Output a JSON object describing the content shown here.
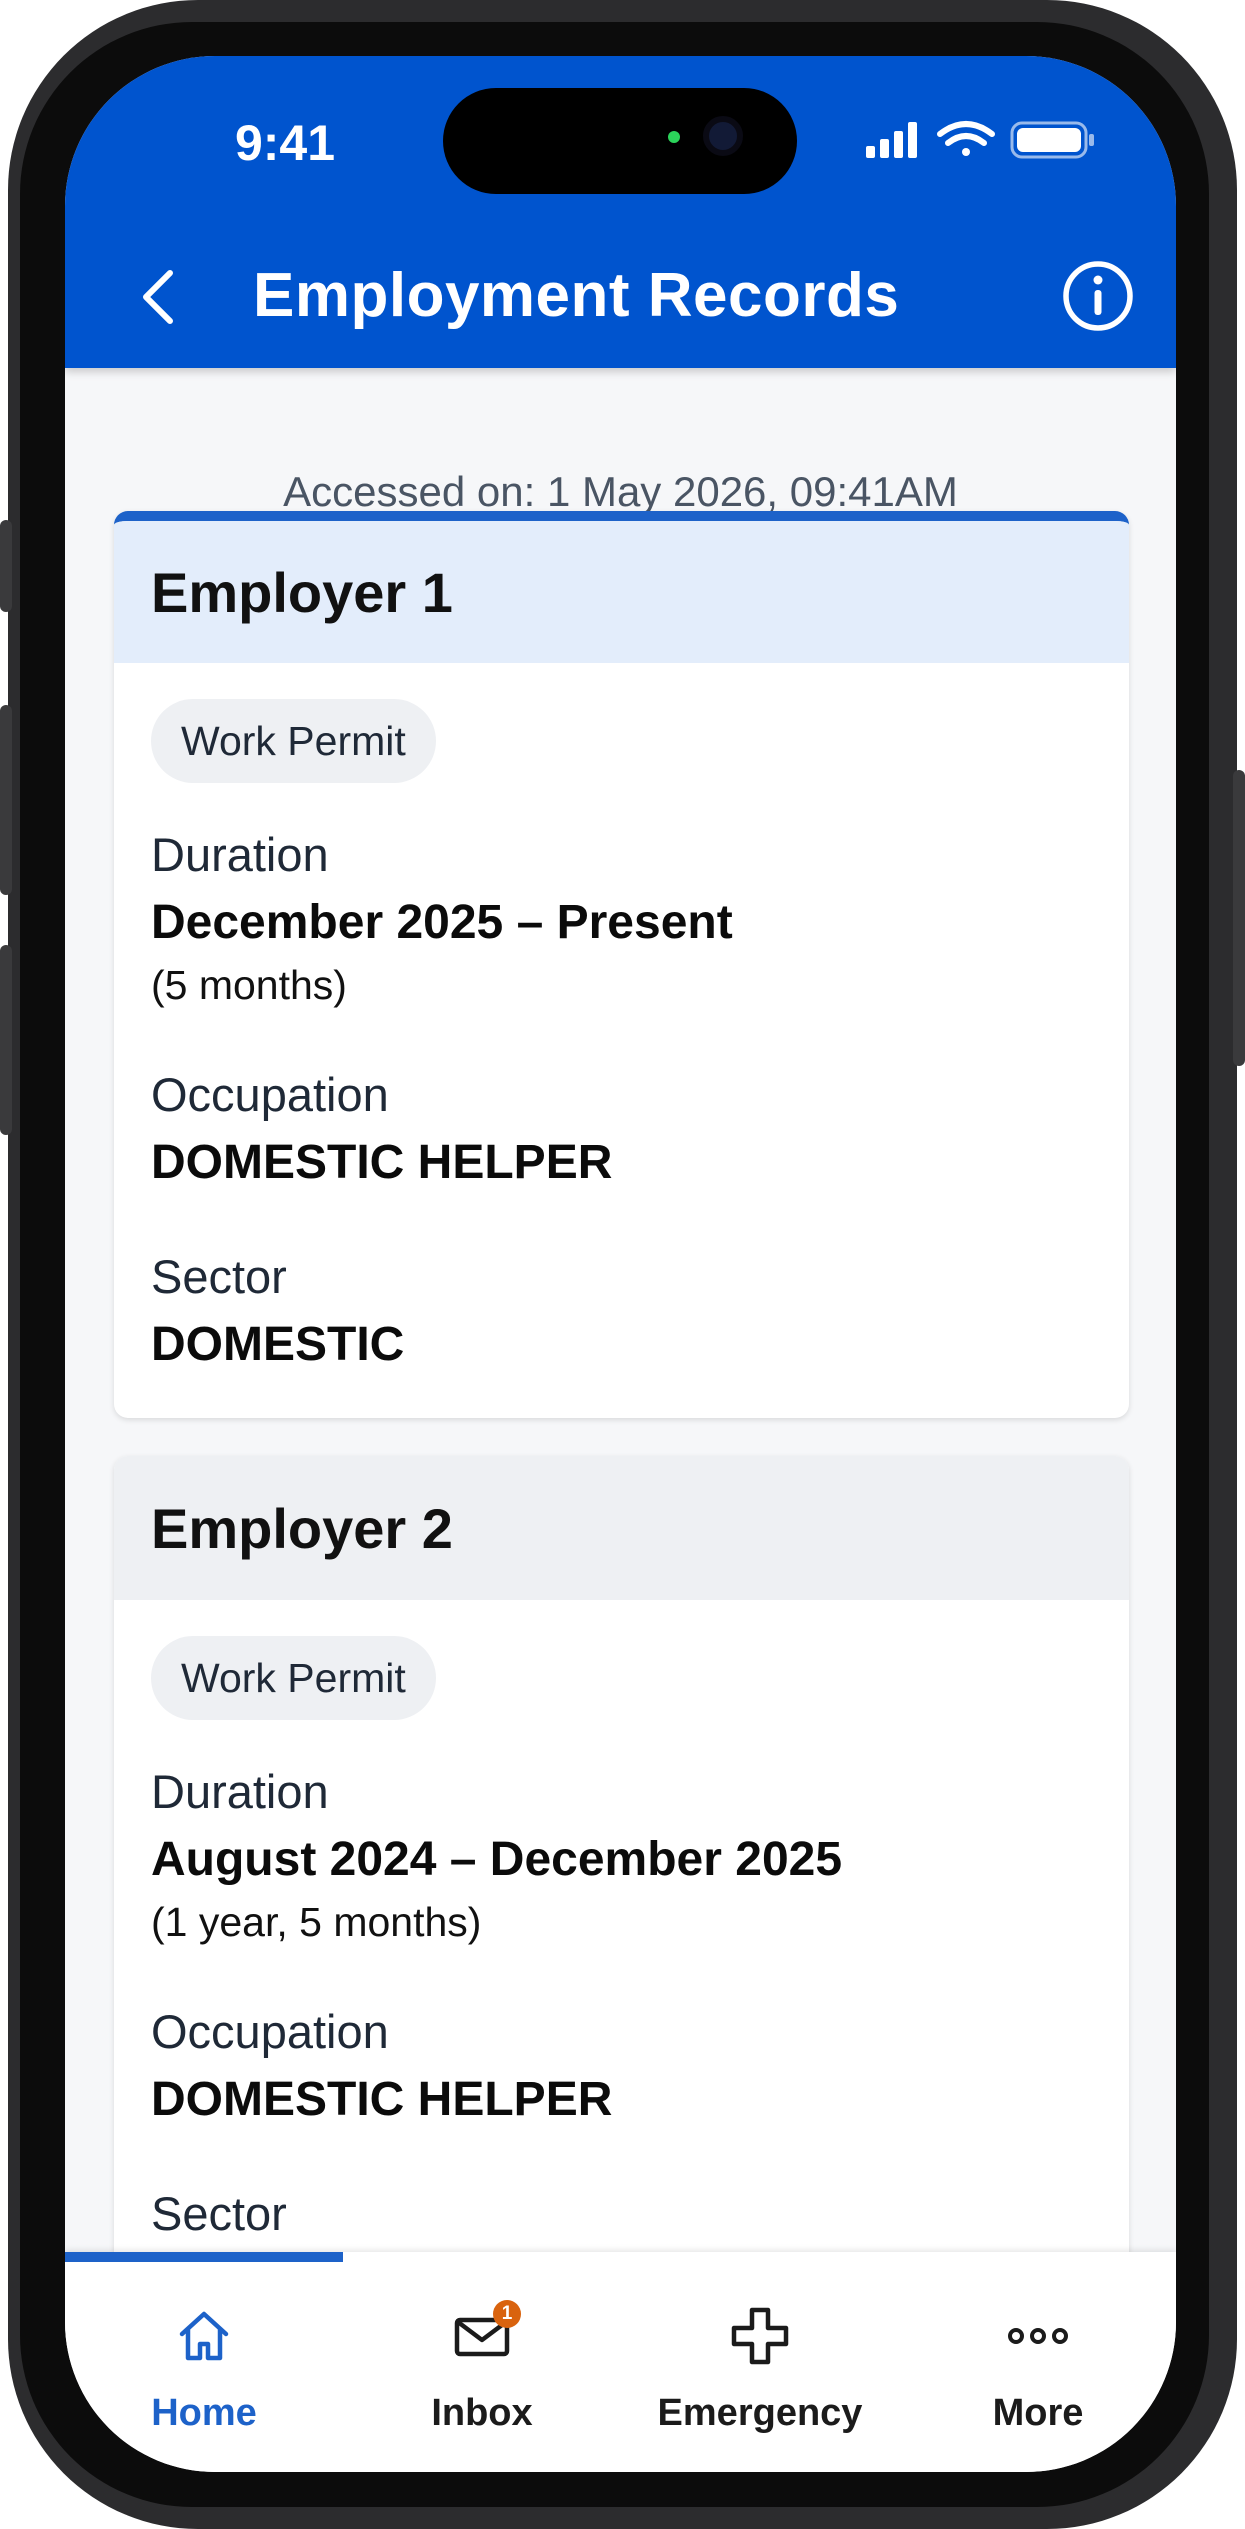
{
  "status_bar": {
    "time": "9:41"
  },
  "header": {
    "title": "Employment Records"
  },
  "accessed_text": "Accessed on: 1 May 2026, 09:41AM",
  "employers": [
    {
      "title": "Employer 1",
      "permit": "Work Permit",
      "duration_label": "Duration",
      "duration": "December 2025 – Present",
      "duration_length": "(5 months)",
      "occupation_label": "Occupation",
      "occupation": "DOMESTIC HELPER",
      "sector_label": "Sector",
      "sector": "DOMESTIC"
    },
    {
      "title": "Employer 2",
      "permit": "Work Permit",
      "duration_label": "Duration",
      "duration": "August 2024 – December 2025",
      "duration_length": "(1 year, 5 months)",
      "occupation_label": "Occupation",
      "occupation": "DOMESTIC HELPER",
      "sector_label": "Sector"
    }
  ],
  "tabs": [
    {
      "label": "Home",
      "icon": "home-icon",
      "active": true
    },
    {
      "label": "Inbox",
      "icon": "mail-icon",
      "badge": "1"
    },
    {
      "label": "Emergency",
      "icon": "medical-cross-icon"
    },
    {
      "label": "More",
      "icon": "more-dots-icon"
    }
  ],
  "colors": {
    "brand_blue": "#0054ce",
    "accent_blue": "#1d62c9",
    "badge_orange": "#d9630e"
  }
}
